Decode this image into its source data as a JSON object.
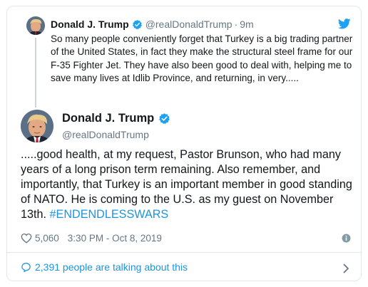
{
  "colors": {
    "accent": "#1b95e0",
    "twitter_blue": "#1da1f2",
    "muted": "#657786",
    "border": "#e1e8ed",
    "text": "#14171a"
  },
  "parent_tweet": {
    "avatar_icon": "trump-avatar",
    "name": "Donald J. Trump",
    "handle": "@realDonaldTrump",
    "separator": "·",
    "time": "9m",
    "verified_icon": "verified-badge-icon",
    "bird_icon": "twitter-bird-icon",
    "text": "So many people conveniently forget that Turkey is a big trading partner of the United States, in fact they make the structural steel frame for our F-35 Fighter Jet. They have also been good to deal with, helping me to save many lives at Idlib Province, and returning, in very....."
  },
  "main_tweet": {
    "avatar_icon": "trump-avatar",
    "name": "Donald J. Trump",
    "handle": "@realDonaldTrump",
    "verified_icon": "verified-badge-icon",
    "text": ".....good health, at my request, Pastor Brunson, who had many years of a long prison term remaining. Also remember, and importantly, that Turkey is an important member in good standing of NATO. He is coming to the U.S. as my guest on November 13th. ",
    "hashtag": "#ENDENDLESSWARS",
    "likes": "5,060",
    "timestamp": "3:30 PM - Oct 8, 2019",
    "heart_icon": "heart-icon",
    "info_icon": "info-icon"
  },
  "footer": {
    "talking_text": "2,391 people are talking about this",
    "bubble_icon": "speech-bubble-icon",
    "chevron_icon": "chevron-right-icon"
  }
}
